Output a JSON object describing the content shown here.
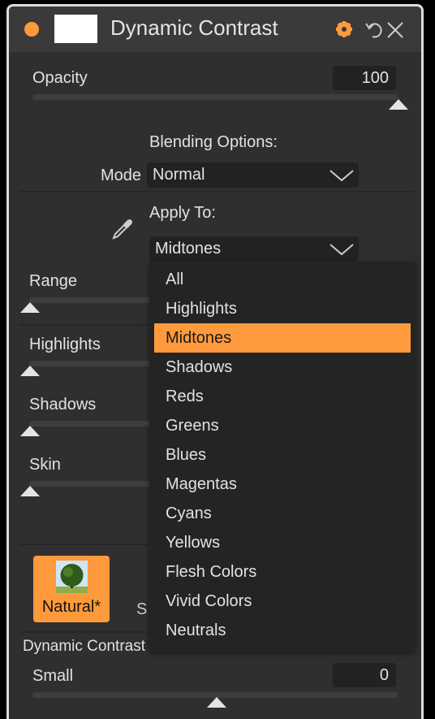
{
  "header": {
    "title": "Dynamic Contrast",
    "status_color": "#ff9a3c",
    "icons": [
      "status-dot",
      "thumbnail",
      "gear-icon",
      "undo-icon",
      "close-icon"
    ]
  },
  "opacity": {
    "label": "Opacity",
    "value": "100",
    "percent": 100
  },
  "blending": {
    "heading": "Blending Options:",
    "mode_label": "Mode",
    "mode_value": "Normal"
  },
  "apply_to": {
    "label": "Apply To:",
    "value": "Midtones",
    "icon": "eyedropper-icon"
  },
  "sliders": [
    {
      "label": "Range",
      "value": 0
    },
    {
      "label": "Highlights",
      "value": 0
    },
    {
      "label": "Shadows",
      "value": 0
    },
    {
      "label": "Skin",
      "value": 0
    }
  ],
  "dropdown": {
    "items": [
      "All",
      "Highlights",
      "Midtones",
      "Shadows",
      "Reds",
      "Greens",
      "Blues",
      "Magentas",
      "Cyans",
      "Yellows",
      "Flesh Colors",
      "Vivid Colors",
      "Neutrals"
    ],
    "selected": "Midtones",
    "accent": "#ff9a3c"
  },
  "preset": {
    "label": "Natural*",
    "partial_label": "S"
  },
  "dynamic_contrast": {
    "section_label": "Dynamic Contrast",
    "small_label": "Small",
    "small_value": "0",
    "small_percent": 50
  }
}
